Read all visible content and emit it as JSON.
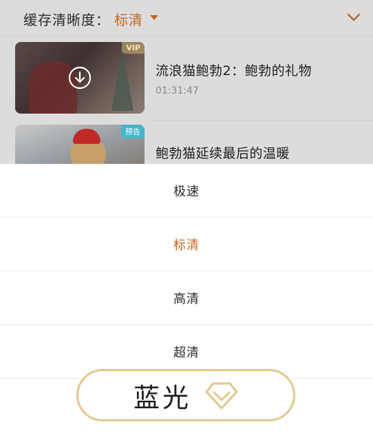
{
  "header": {
    "label": "缓存清晰度：",
    "value": "标清",
    "colors": {
      "accent": "#c8641f"
    },
    "icons": [
      "caret-down-icon",
      "chevron-down-icon"
    ]
  },
  "videos": [
    {
      "title": "流浪猫鲍勃2：鲍勃的礼物",
      "duration": "01:31:47",
      "badge": "VIP",
      "icon": "download-icon"
    },
    {
      "title": "鲍勃猫延续最后的温暖",
      "badge": "预告"
    }
  ],
  "quality_options": [
    {
      "label": "极速",
      "selected": false
    },
    {
      "label": "标清",
      "selected": true
    },
    {
      "label": "高清",
      "selected": false
    },
    {
      "label": "超清",
      "selected": false
    }
  ],
  "bluray": {
    "label": "蓝光",
    "icon": "diamond-icon",
    "border_color": "#e2c68c"
  }
}
